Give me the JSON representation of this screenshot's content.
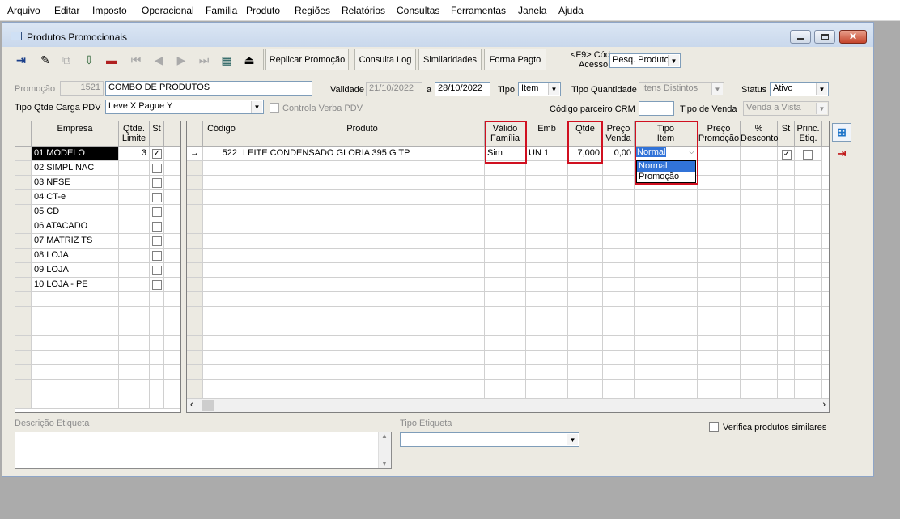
{
  "menu": [
    "Arquivo",
    "Editar",
    "Imposto",
    "Operacional",
    "Família",
    "Produto",
    "Regiões",
    "Relatórios",
    "Consultas",
    "Ferramentas",
    "Janela",
    "Ajuda"
  ],
  "window": {
    "title": "Produtos Promocionais"
  },
  "toolbar": {
    "icons": [
      "exit-icon",
      "edit-icon",
      "duplicate-icon",
      "save-icon",
      "delete-icon",
      "first-icon",
      "prev-icon",
      "next-icon",
      "last-icon",
      "grid-icon",
      "export-icon"
    ],
    "buttons": [
      "Replicar Promoção",
      "Consulta Log",
      "Similaridades",
      "Forma Pagto"
    ],
    "f9_label": "<F9> Cód",
    "acesso_label": "Acesso",
    "pesq_value": "Pesq. Produto"
  },
  "form": {
    "promocao_label": "Promoção",
    "promocao_code": "1521",
    "promocao_name": "COMBO DE PRODUTOS",
    "validade_label": "Validade",
    "validade_from": "21/10/2022",
    "a_label": "a",
    "validade_to": "28/10/2022",
    "tipo_label": "Tipo",
    "tipo_value": "Item",
    "tipo_qtd_label": "Tipo Quantidade",
    "tipo_qtd_value": "Itens Distintos",
    "status_label": "Status",
    "status_value": "Ativo",
    "carga_label": "Tipo Qtde Carga PDV",
    "carga_value": "Leve X Pague Y",
    "controla_label": "Controla Verba PDV",
    "crm_label": "Código parceiro CRM",
    "crm_value": "",
    "tipo_venda_label": "Tipo de Venda",
    "tipo_venda_value": "Venda a Vista"
  },
  "empresa_grid": {
    "headers": {
      "empresa": "Empresa",
      "qtde1": "Qtde.",
      "qtde2": "Limite",
      "st": "St"
    },
    "rows": [
      {
        "name": "01 MODELO",
        "limit": "3",
        "checked": true
      },
      {
        "name": "02 SIMPL NAC",
        "limit": "",
        "checked": false
      },
      {
        "name": "03 NFSE",
        "limit": "",
        "checked": false
      },
      {
        "name": "04 CT-e",
        "limit": "",
        "checked": false
      },
      {
        "name": "05 CD",
        "limit": "",
        "checked": false
      },
      {
        "name": "06 ATACADO",
        "limit": "",
        "checked": false
      },
      {
        "name": "07 MATRIZ TS",
        "limit": "",
        "checked": false
      },
      {
        "name": "08 LOJA",
        "limit": "",
        "checked": false
      },
      {
        "name": "09 LOJA",
        "limit": "",
        "checked": false
      },
      {
        "name": "10 LOJA - PE",
        "limit": "",
        "checked": false
      }
    ]
  },
  "produto_grid": {
    "headers": {
      "codigo": "Código",
      "produto": "Produto",
      "valido1": "Válido",
      "valido2": "Família",
      "emb": "Emb",
      "qtde": "Qtde",
      "preco1": "Preço",
      "preco2": "Venda",
      "tipo1": "Tipo",
      "tipo2": "Item",
      "precop1": "Preço",
      "precop2": "Promoção",
      "desc1": "%",
      "desc2": "Desconto",
      "st": "St",
      "princ1": "Princ.",
      "princ2": "Etiq."
    },
    "row": {
      "codigo": "522",
      "produto": "LEITE CONDENSADO GLORIA 395 G TP",
      "valido": "Sim",
      "emb": "UN  1",
      "qtde": "7,000",
      "preco_venda": "0,00",
      "tipo_item": "Normal"
    },
    "dropdown_options": [
      "Normal",
      "Promoção"
    ]
  },
  "bottom": {
    "descricao_label": "Descrição Etiqueta",
    "tipo_etiqueta_label": "Tipo Etiqueta",
    "verifica_label": "Verifica produtos similares"
  }
}
